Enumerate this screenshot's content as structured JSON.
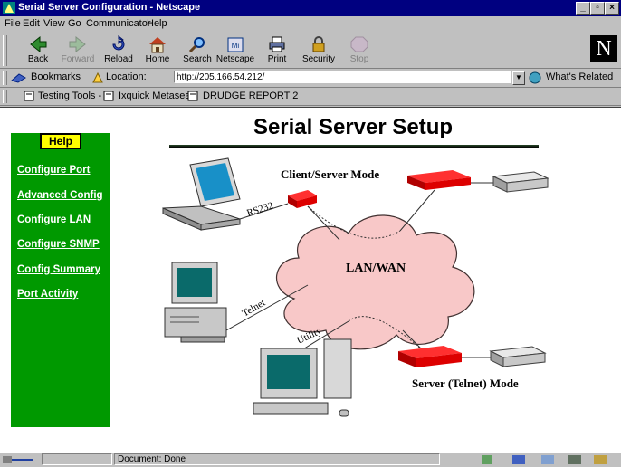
{
  "window": {
    "title": "Serial Server Configuration - Netscape"
  },
  "menu": [
    "File",
    "Edit",
    "View",
    "Go",
    "Communicator",
    "Help"
  ],
  "toolbar": {
    "buttons": [
      {
        "label": "Back",
        "icon": "back-arrow-icon",
        "enabled": true
      },
      {
        "label": "Forward",
        "icon": "forward-arrow-icon",
        "enabled": false
      },
      {
        "label": "Reload",
        "icon": "reload-icon",
        "enabled": true
      },
      {
        "label": "Home",
        "icon": "home-icon",
        "enabled": true
      },
      {
        "label": "Search",
        "icon": "search-icon",
        "enabled": true
      },
      {
        "label": "Netscape",
        "icon": "netscape-icon",
        "enabled": true
      },
      {
        "label": "Print",
        "icon": "print-icon",
        "enabled": true
      },
      {
        "label": "Security",
        "icon": "lock-icon",
        "enabled": true
      },
      {
        "label": "Stop",
        "icon": "stop-icon",
        "enabled": false
      }
    ],
    "logo": "N"
  },
  "location": {
    "bookmarks_label": "Bookmarks",
    "location_label": "Location:",
    "url": "http://205.166.54.212/",
    "whats_related": "What's Related"
  },
  "personal_toolbar": [
    "Testing Tools -",
    "Ixquick Metasea",
    "DRUDGE REPORT 2"
  ],
  "page": {
    "title": "Serial Server Setup",
    "help_button": "Help",
    "nav_links": [
      "Configure Port",
      "Advanced Config",
      "Configure LAN",
      "Configure SNMP",
      "Config Summary",
      "Port Activity"
    ],
    "diagram": {
      "client_server_mode": "Client/Server Mode",
      "lan_wan": "LAN/WAN",
      "server_telnet_mode": "Server (Telnet) Mode",
      "rs232": "RS232",
      "telnet": "Telnet",
      "utility": "Utility"
    },
    "colors": {
      "sidebar": "#009900",
      "help_bg": "#ffff00",
      "cloud": "#f8c8c8",
      "device_red": "#dd0000"
    }
  },
  "status": {
    "text": "Document: Done"
  }
}
